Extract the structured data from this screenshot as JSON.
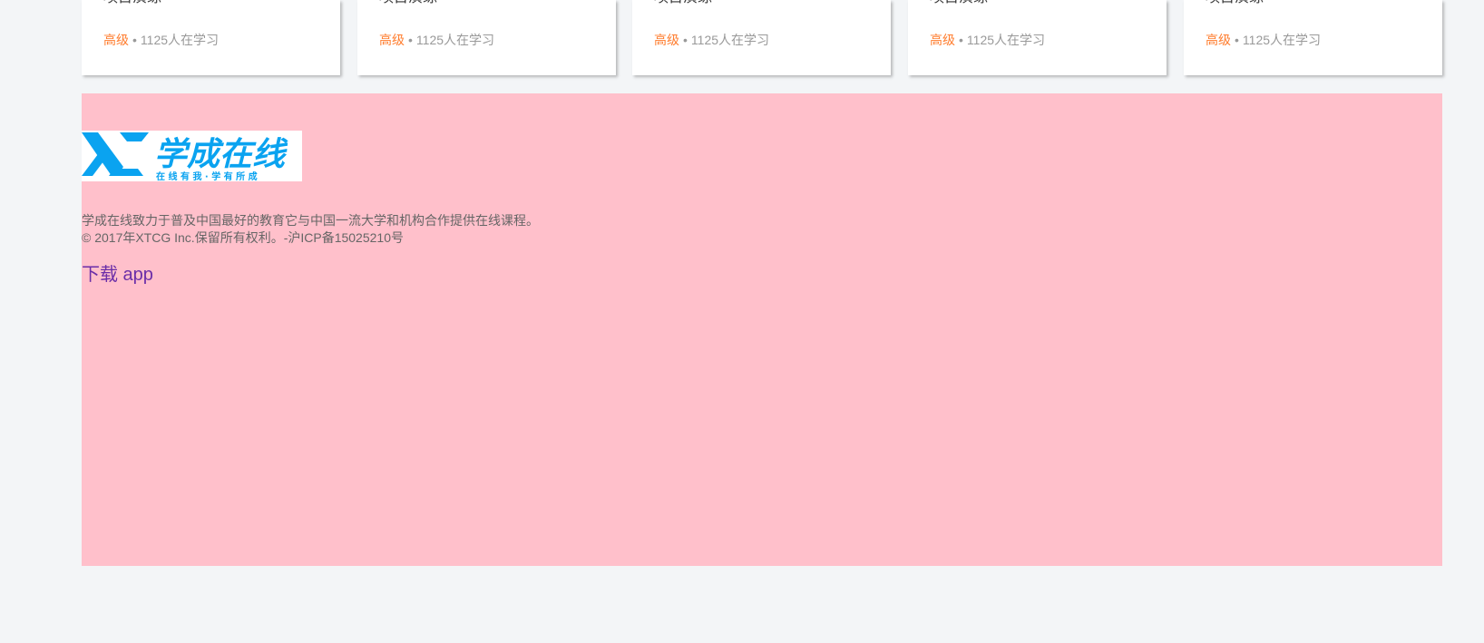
{
  "cards": [
    {
      "title": "项目演练",
      "level": "高级",
      "separator": "•",
      "learners": "1125人在学习"
    },
    {
      "title": "项目演练",
      "level": "高级",
      "separator": "•",
      "learners": "1125人在学习"
    },
    {
      "title": "项目演练",
      "level": "高级",
      "separator": "•",
      "learners": "1125人在学习"
    },
    {
      "title": "项目演练",
      "level": "高级",
      "separator": "•",
      "learners": "1125人在学习"
    },
    {
      "title": "项目演练",
      "level": "高级",
      "separator": "•",
      "learners": "1125人在学习"
    }
  ],
  "footer": {
    "logo": {
      "brand": "学成在线",
      "tagline": "在 线 有 我 · 学 有 所 成",
      "color": "#0aa3f0"
    },
    "description": "学成在线致力于普及中国最好的教育它与中国一流大学和机构合作提供在线课程。",
    "copyright": "© 2017年XTCG Inc.保留所有权利。-沪ICP备15025210号",
    "download_label": "下载 app",
    "background": "#ffc0cb"
  },
  "colors": {
    "page_background": "#f3f5f7",
    "level_text": "#ff7c2d",
    "muted_text": "#999999",
    "link": "#6b2ea8"
  }
}
